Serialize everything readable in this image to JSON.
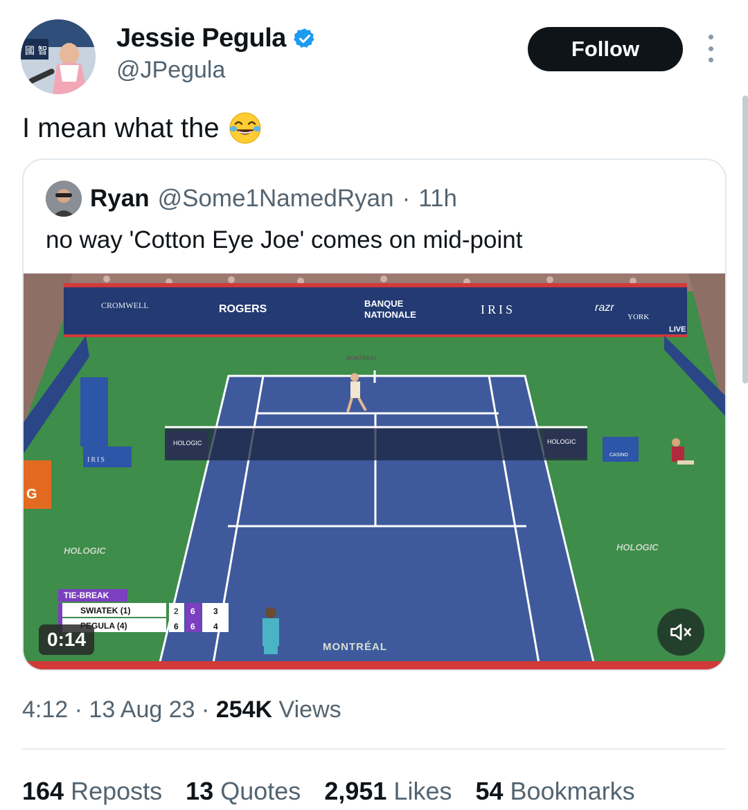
{
  "author": {
    "display_name": "Jessie Pegula",
    "handle": "@JPegula",
    "verified_icon": "verified-badge-icon",
    "avatar_scoreboard_text": "國 智"
  },
  "follow_label": "Follow",
  "tweet_text": "I mean what the",
  "tweet_emoji": "face-with-tears-of-joy",
  "quote": {
    "name": "Ryan",
    "handle": "@Some1NamedRyan",
    "separator": "·",
    "time": "11h",
    "text": "no way 'Cotton Eye Joe' comes on mid-point"
  },
  "video": {
    "duration": "0:14",
    "sponsors": {
      "cromwell": "CROMWELL",
      "rogers": "ROGERS",
      "banque_1": "BANQUE",
      "banque_2": "NATIONALE",
      "iris": "IRIS",
      "razr": "razr",
      "york": "YORK",
      "live": "LIVE",
      "hologic": "HOLOGIC",
      "montreal": "MONTRÉAL",
      "montreal_far": "MONTREAL",
      "iris_chair": "IRIS",
      "casino": "CASINO"
    },
    "scoreboard": {
      "label": "TIE-BREAK",
      "players": [
        {
          "name": "SWIATEK (1)",
          "set1": "2",
          "set2": "6",
          "game": "3"
        },
        {
          "name": "PEGULA (4)",
          "set1": "6",
          "set2": "6",
          "game": "4"
        }
      ]
    }
  },
  "meta": {
    "time": "4:12",
    "date": "13 Aug 23",
    "sep": "·",
    "views_count": "254K",
    "views_label": "Views"
  },
  "stats": [
    {
      "count": "164",
      "label": "Reposts"
    },
    {
      "count": "13",
      "label": "Quotes"
    },
    {
      "count": "2,951",
      "label": "Likes"
    },
    {
      "count": "54",
      "label": "Bookmarks"
    }
  ],
  "colors": {
    "court_blue": "#3f5a9c",
    "court_green": "#3e8d4a",
    "follow_bg": "#0f1419",
    "verified": "#1d9bf0",
    "muted_text": "#536471"
  }
}
